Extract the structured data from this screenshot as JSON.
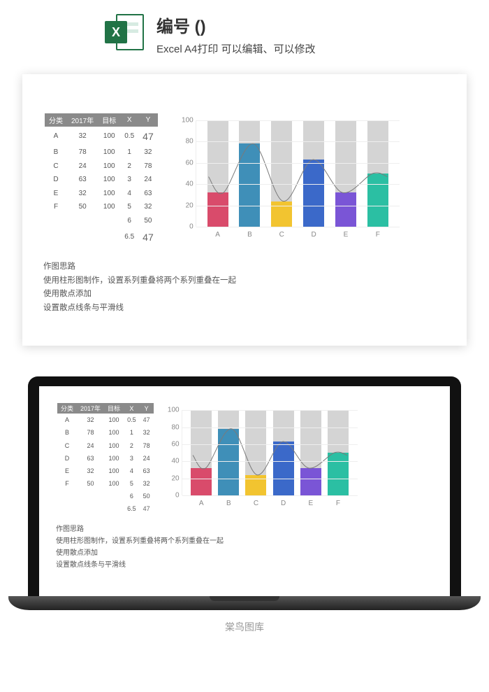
{
  "header": {
    "title": "编号 ()",
    "subtitle": "Excel A4打印 可以编辑、可以修改"
  },
  "table": {
    "headers": [
      "分类",
      "2017年",
      "目标",
      "X",
      "Y"
    ],
    "rows": [
      [
        "A",
        "32",
        "100",
        "0.5",
        "47"
      ],
      [
        "B",
        "78",
        "100",
        "1",
        "32"
      ],
      [
        "C",
        "24",
        "100",
        "2",
        "78"
      ],
      [
        "D",
        "63",
        "100",
        "3",
        "24"
      ],
      [
        "E",
        "32",
        "100",
        "4",
        "63"
      ],
      [
        "F",
        "50",
        "100",
        "5",
        "32"
      ],
      [
        "",
        "",
        "",
        "6",
        "50"
      ],
      [
        "",
        "",
        "",
        "6.5",
        "47"
      ]
    ]
  },
  "notes": {
    "l1": "作图思路",
    "l2": "使用柱形图制作，设置系列重叠将两个系列重叠在一起",
    "l3": "使用散点添加",
    "l4": "设置散点线条与平滑线"
  },
  "brand": "棠鸟图库",
  "chart_data": {
    "type": "bar",
    "title": "",
    "xlabel": "",
    "ylabel": "",
    "ylim": [
      0,
      100
    ],
    "yticks": [
      0,
      20,
      40,
      60,
      80,
      100
    ],
    "categories": [
      "A",
      "B",
      "C",
      "D",
      "E",
      "F"
    ],
    "series": [
      {
        "name": "目标",
        "values": [
          100,
          100,
          100,
          100,
          100,
          100
        ],
        "color": "#d4d4d4"
      },
      {
        "name": "2017年",
        "values": [
          32,
          78,
          24,
          63,
          32,
          50
        ],
        "colors": [
          "#d94b6b",
          "#3f8fb8",
          "#f2c430",
          "#3b69c9",
          "#7a55d6",
          "#2bbfa3"
        ]
      }
    ],
    "overlay_line": {
      "type": "spline",
      "color": "#7a7a7a",
      "x": [
        0.5,
        1,
        2,
        3,
        4,
        5,
        6,
        6.5
      ],
      "y": [
        47,
        32,
        78,
        24,
        63,
        32,
        50,
        47
      ]
    }
  }
}
